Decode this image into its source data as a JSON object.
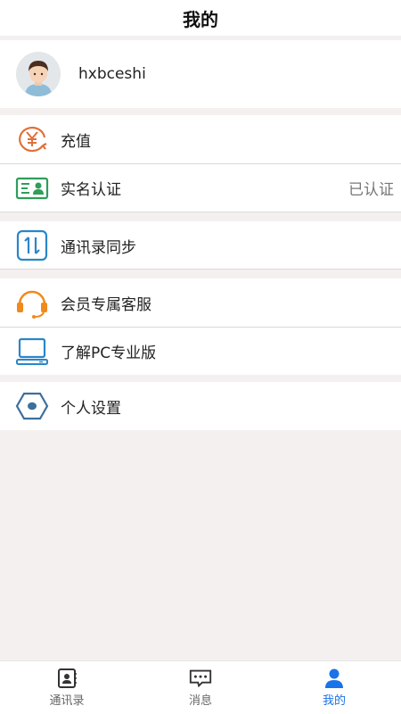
{
  "header": {
    "title": "我的"
  },
  "profile": {
    "username": "hxbceshi"
  },
  "menu": {
    "recharge": {
      "label": "充值",
      "icon": "yen-circle-icon",
      "color": "#e0703a"
    },
    "verify": {
      "label": "实名认证",
      "value": "已认证",
      "icon": "id-card-icon",
      "color": "#2e9e5b"
    },
    "sync": {
      "label": "通讯录同步",
      "icon": "sync-arrows-icon",
      "color": "#2a86c8"
    },
    "service": {
      "label": "会员专属客服",
      "icon": "headset-icon",
      "color": "#f08a1c"
    },
    "pc": {
      "label": "了解PC专业版",
      "icon": "laptop-icon",
      "color": "#2a86c8"
    },
    "settings": {
      "label": "个人设置",
      "icon": "hexagon-gear-icon",
      "color": "#3d6f9e"
    }
  },
  "tabbar": {
    "contacts": {
      "label": "通讯录",
      "icon": "contacts-book-icon"
    },
    "messages": {
      "label": "消息",
      "icon": "chat-bubble-icon"
    },
    "mine": {
      "label": "我的",
      "icon": "person-icon",
      "active": true
    },
    "active_color": "#1a73e8"
  }
}
